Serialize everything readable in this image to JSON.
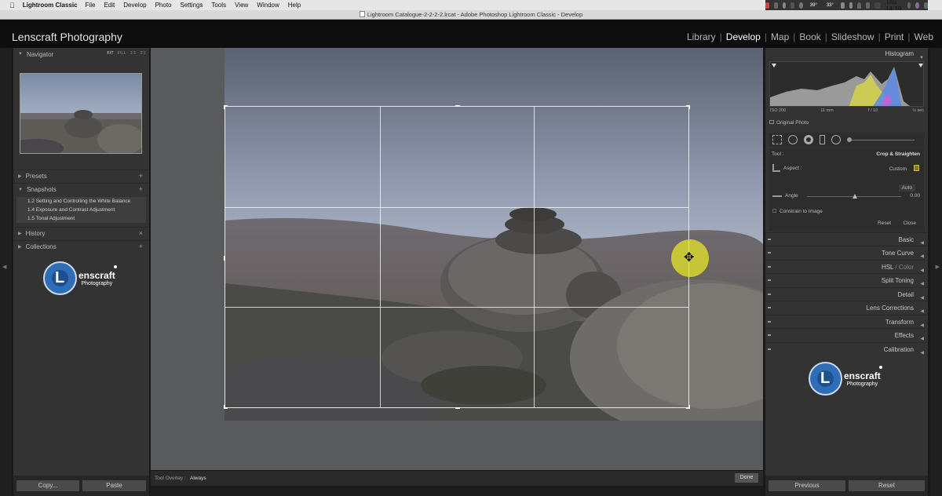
{
  "macbar": {
    "app": "Lightroom Classic",
    "menus": [
      "File",
      "Edit",
      "Develop",
      "Photo",
      "Settings",
      "Tools",
      "View",
      "Window",
      "Help"
    ],
    "temp1": "39°",
    "temp2": "33°",
    "clock": "Thu 14:19"
  },
  "window": {
    "title": "Lightroom Catalogue-2-2-2-2.lrcat - Adobe Photoshop Lightroom Classic - Develop"
  },
  "identity": {
    "brand": "Lenscraft Photography",
    "modules": [
      "Library",
      "Develop",
      "Map",
      "Book",
      "Slideshow",
      "Print",
      "Web"
    ],
    "active_module": "Develop"
  },
  "left": {
    "navigator": {
      "title": "Navigator",
      "zoom": [
        "FIT",
        "FILL",
        "1:1",
        "2:1"
      ]
    },
    "presets": "Presets",
    "snapshots": {
      "title": "Snapshots",
      "items": [
        "1.2 Setting and Controlling the White Balance",
        "1.4 Exposure and Contrast Adjustment",
        "1.5 Tonal Adjustment"
      ]
    },
    "history": "History",
    "collections": "Collections",
    "copy_label": "Copy...",
    "paste_label": "Paste"
  },
  "logo": {
    "line1": "enscraft",
    "line2": "Photography",
    "letter": "L"
  },
  "toolbar": {
    "overlay_label": "Tool Overlay :",
    "overlay_value": "Always",
    "done_label": "Done"
  },
  "right": {
    "histogram": "Histogram",
    "exif": {
      "iso": "ISO 200",
      "focal": "11 mm",
      "aperture": "f / 10",
      "shutter": "½ sec"
    },
    "original_photo": "Original Photo",
    "crop": {
      "tool_label": "Tool :",
      "tool_name": "Crop & Straighten",
      "aspect_label": "Aspect :",
      "aspect_value": "Custom",
      "auto_label": "Auto",
      "angle_label": "Angle",
      "angle_value": "0.00",
      "constrain_label": "Constrain to Image",
      "reset_label": "Reset",
      "close_label": "Close"
    },
    "sections": [
      "Basic",
      "Tone Curve",
      "HSL",
      "Color",
      "Split Toning",
      "Detail",
      "Lens Corrections",
      "Transform",
      "Effects",
      "Calibration"
    ],
    "previous_label": "Previous",
    "reset_label": "Reset"
  },
  "colors": {
    "accent_highlight": "#e6e628",
    "logo_blue": "#2f6db6"
  }
}
